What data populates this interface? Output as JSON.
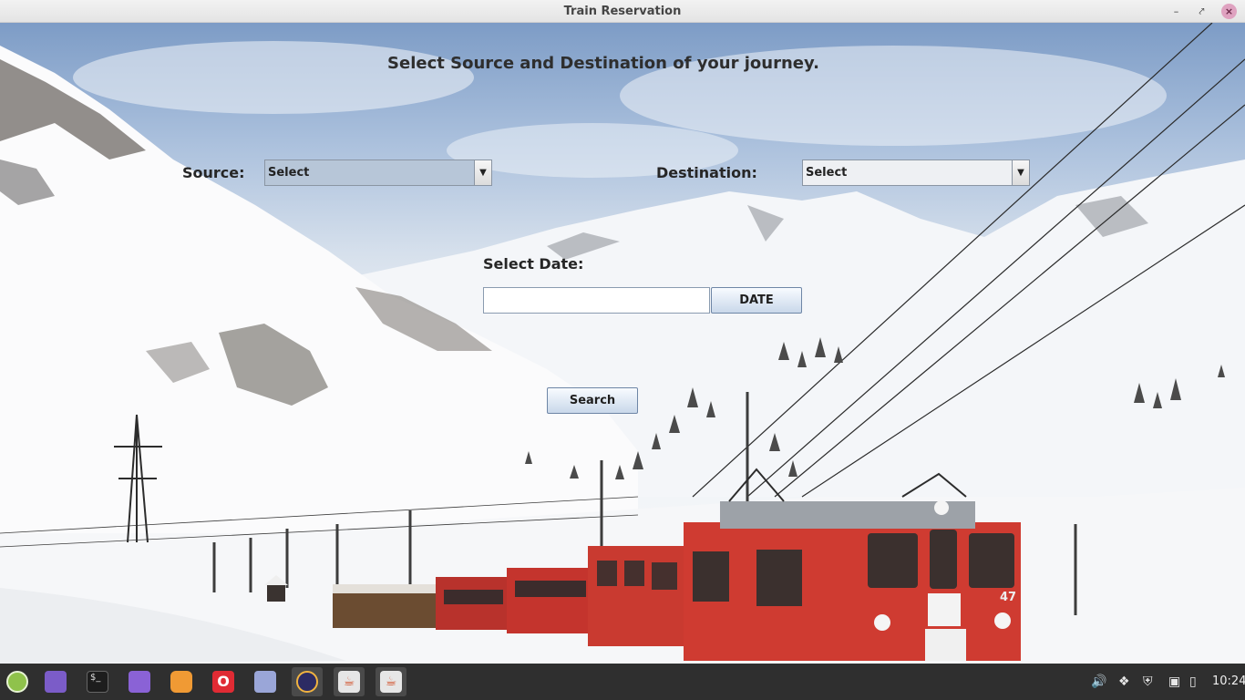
{
  "window": {
    "title": "Train Reservation"
  },
  "form": {
    "heading": "Select Source and Destination of your journey.",
    "source_label": "Source:",
    "source_value": "Select",
    "destination_label": "Destination:",
    "destination_value": "Select",
    "date_label": "Select Date:",
    "date_value": "",
    "date_button": "DATE",
    "search_button": "Search"
  },
  "scene": {
    "train_number": "47"
  },
  "taskbar": {
    "apps": [
      "linux-mint-menu-icon",
      "folder-icon",
      "terminal-icon",
      "folder-icon",
      "firefox-icon",
      "opera-icon",
      "text-editor-icon",
      "eclipse-icon",
      "java-icon",
      "java-icon"
    ],
    "tray": [
      "volume-icon",
      "bluetooth-icon",
      "shield-icon",
      "network-icon"
    ],
    "clock": "10:24"
  },
  "colors": {
    "accent_red": "#c8302b",
    "taskbar": "#2f2f2f",
    "button_top": "#f8fbff",
    "button_bottom": "#c9d8ea"
  }
}
